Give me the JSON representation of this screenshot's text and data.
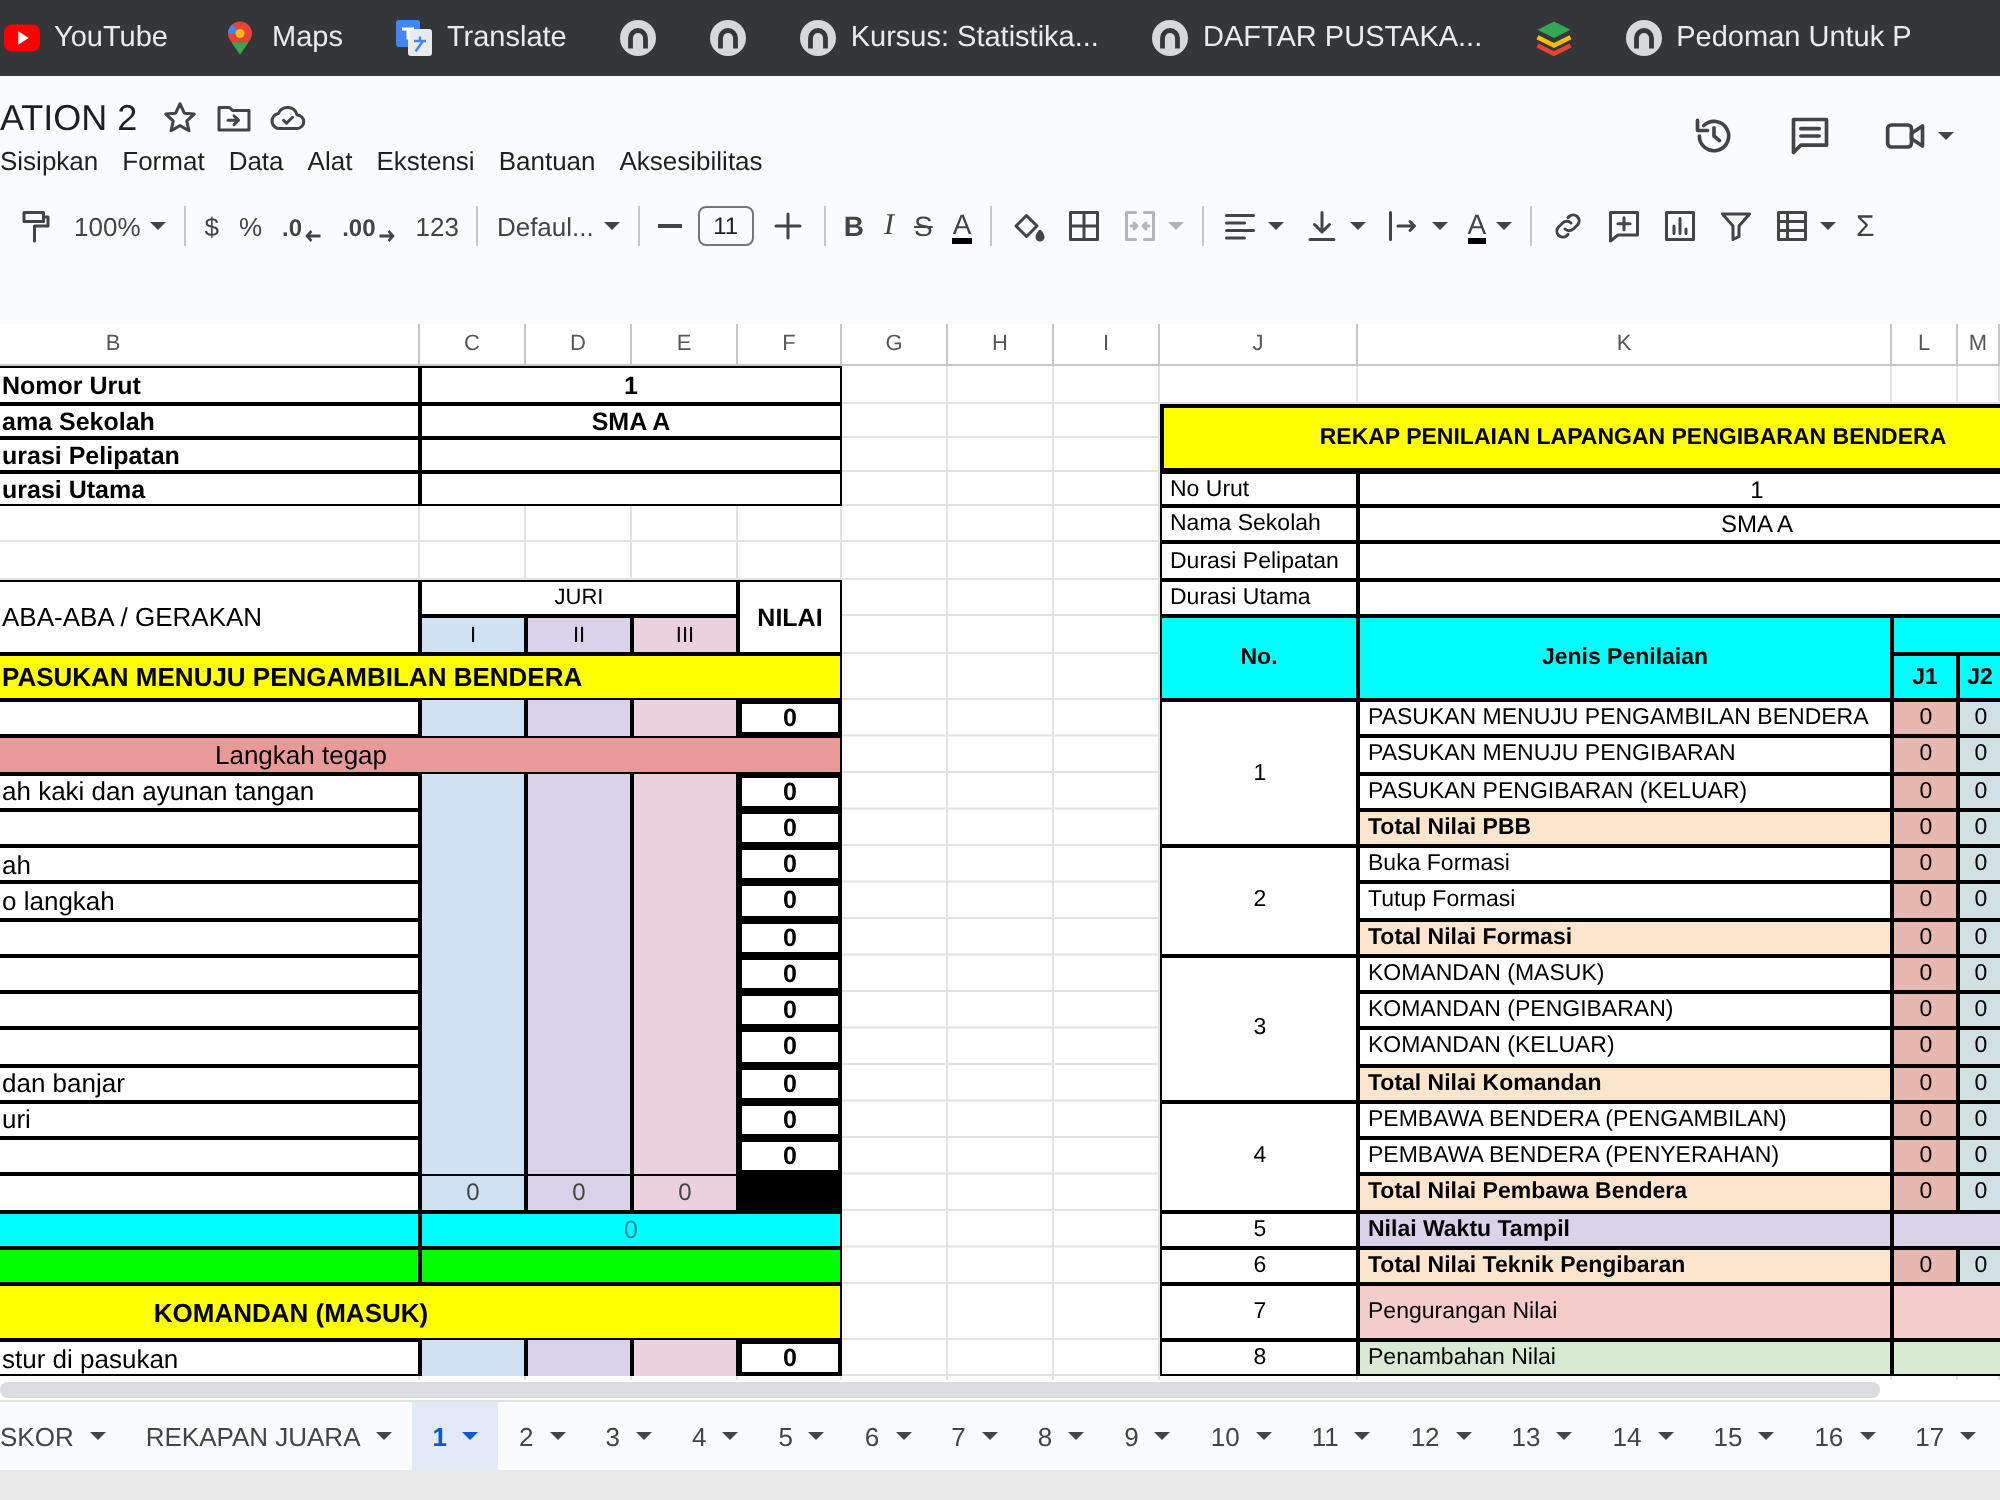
{
  "bookmarks": [
    {
      "kind": "youtube",
      "label": "YouTube"
    },
    {
      "kind": "maps",
      "label": "Maps"
    },
    {
      "kind": "translate",
      "label": "Translate"
    },
    {
      "kind": "site"
    },
    {
      "kind": "site"
    },
    {
      "kind": "site",
      "label": "Kursus: Statistika..."
    },
    {
      "kind": "site",
      "label": "DAFTAR PUSTAKA..."
    },
    {
      "kind": "stack"
    },
    {
      "kind": "site",
      "label": "Pedoman Untuk P"
    }
  ],
  "document": {
    "title": "ATION 2",
    "menu": [
      "Sisipkan",
      "Format",
      "Data",
      "Alat",
      "Ekstensi",
      "Bantuan",
      "Aksesibilitas"
    ]
  },
  "toolbar": {
    "zoom": "100%",
    "currency": "$",
    "percent": "%",
    "decimal_decrease": ".0",
    "decimal_increase": ".00",
    "number_format": "123",
    "font": "Defaul...",
    "font_size": "11",
    "bold": "B",
    "italic": "I",
    "strikethrough": "S",
    "text_color": "A",
    "merge_disabled": true,
    "text_rotation": "A",
    "functions": "Σ"
  },
  "sheet_columns": [
    "B",
    "C",
    "D",
    "E",
    "F",
    "G",
    "H",
    "I",
    "J",
    "K",
    "L",
    "M"
  ],
  "score_sheet": {
    "info": [
      {
        "label": "Nomor Urut",
        "value": "1"
      },
      {
        "label": "ama Sekolah",
        "value": "SMA A"
      },
      {
        "label": "urasi Pelipatan"
      },
      {
        "label": "urasi Utama"
      }
    ],
    "header": {
      "label": "ABA-ABA / GERAKAN",
      "jury": "JURI",
      "judges": [
        "I",
        "II",
        "III"
      ],
      "total": "NILAI"
    },
    "rows": [
      {
        "kind": "section",
        "label": "PASUKAN MENUJU PENGAMBILAN BENDERA"
      },
      {
        "kind": "item",
        "score": "0"
      },
      {
        "kind": "subheader",
        "label": "Langkah tegap"
      },
      {
        "kind": "item",
        "label": "ah kaki dan ayunan tangan",
        "score": "0"
      },
      {
        "kind": "item",
        "score": "0"
      },
      {
        "kind": "item",
        "label": "ah",
        "score": "0"
      },
      {
        "kind": "item",
        "label": "o langkah",
        "score": "0"
      },
      {
        "kind": "item",
        "score": "0"
      },
      {
        "kind": "item",
        "score": "0"
      },
      {
        "kind": "item",
        "score": "0"
      },
      {
        "kind": "item",
        "score": "0"
      },
      {
        "kind": "item",
        "label": "dan banjar",
        "score": "0"
      },
      {
        "kind": "item",
        "label": "uri",
        "score": "0"
      },
      {
        "kind": "item",
        "score": "0"
      },
      {
        "kind": "totals",
        "values": [
          "0",
          "0",
          "0"
        ]
      },
      {
        "kind": "average",
        "value": "0"
      },
      {
        "kind": "final"
      },
      {
        "kind": "title",
        "label": "KOMANDAN (MASUK)"
      },
      {
        "kind": "item",
        "label": "stur di pasukan",
        "score": "0"
      }
    ]
  },
  "rekap": {
    "title": "REKAP PENILAIAN LAPANGAN PENGIBARAN BENDERA",
    "info": [
      {
        "label": "No Urut",
        "value": "1"
      },
      {
        "label": "Nama Sekolah",
        "value": "SMA A"
      },
      {
        "label": "Durasi Pelipatan"
      },
      {
        "label": "Durasi Utama"
      }
    ],
    "columns": {
      "number": "No.",
      "category": "Jenis Penilaian",
      "judges": [
        "J1",
        "J2"
      ]
    },
    "groups": [
      {
        "number": "1",
        "rows": [
          {
            "kind": "item",
            "label": "PASUKAN MENUJU PENGAMBILAN BENDERA",
            "scores": [
              "0",
              "0"
            ]
          },
          {
            "kind": "item",
            "label": "PASUKAN MENUJU PENGIBARAN",
            "scores": [
              "0",
              "0"
            ]
          },
          {
            "kind": "item",
            "label": "PASUKAN PENGIBARAN (KELUAR)",
            "scores": [
              "0",
              "0"
            ]
          },
          {
            "kind": "total",
            "label": "Total Nilai PBB",
            "scores": [
              "0",
              "0"
            ]
          }
        ]
      },
      {
        "number": "2",
        "rows": [
          {
            "kind": "item",
            "label": "Buka Formasi",
            "scores": [
              "0",
              "0"
            ]
          },
          {
            "kind": "item",
            "label": "Tutup Formasi",
            "scores": [
              "0",
              "0"
            ]
          },
          {
            "kind": "total",
            "label": "Total Nilai Formasi",
            "scores": [
              "0",
              "0"
            ]
          }
        ]
      },
      {
        "number": "3",
        "rows": [
          {
            "kind": "item",
            "label": "KOMANDAN (MASUK)",
            "scores": [
              "0",
              "0"
            ]
          },
          {
            "kind": "item",
            "label": "KOMANDAN (PENGIBARAN)",
            "scores": [
              "0",
              "0"
            ]
          },
          {
            "kind": "item",
            "label": "KOMANDAN (KELUAR)",
            "scores": [
              "0",
              "0"
            ]
          },
          {
            "kind": "total",
            "label": "Total Nilai Komandan",
            "scores": [
              "0",
              "0"
            ]
          }
        ]
      },
      {
        "number": "4",
        "rows": [
          {
            "kind": "item",
            "label": "PEMBAWA BENDERA (PENGAMBILAN)",
            "scores": [
              "0",
              "0"
            ]
          },
          {
            "kind": "item",
            "label": "PEMBAWA BENDERA (PENYERAHAN)",
            "scores": [
              "0",
              "0"
            ]
          },
          {
            "kind": "total",
            "label": "Total Nilai Pembawa Bendera",
            "scores": [
              "0",
              "0"
            ]
          }
        ]
      },
      {
        "number": "5",
        "rows": [
          {
            "kind": "time",
            "label": "Nilai Waktu Tampil"
          }
        ]
      },
      {
        "number": "6",
        "rows": [
          {
            "kind": "total",
            "label": "Total Nilai Teknik Pengibaran",
            "scores": [
              "0",
              "0"
            ]
          }
        ]
      },
      {
        "number": "7",
        "rows": [
          {
            "kind": "minus",
            "label": "Pengurangan Nilai"
          }
        ]
      },
      {
        "number": "8",
        "rows": [
          {
            "kind": "plus",
            "label": "Penambahan Nilai"
          }
        ]
      }
    ]
  },
  "sheet_tabs": [
    {
      "label": "SKOR",
      "selected": false
    },
    {
      "label": "REKAPAN JUARA",
      "selected": false
    },
    {
      "label": "1",
      "selected": true
    },
    {
      "label": "2",
      "selected": false
    },
    {
      "label": "3",
      "selected": false
    },
    {
      "label": "4",
      "selected": false
    },
    {
      "label": "5",
      "selected": false
    },
    {
      "label": "6",
      "selected": false
    },
    {
      "label": "7",
      "selected": false
    },
    {
      "label": "8",
      "selected": false
    },
    {
      "label": "9",
      "selected": false
    },
    {
      "label": "10",
      "selected": false
    },
    {
      "label": "11",
      "selected": false
    },
    {
      "label": "12",
      "selected": false
    },
    {
      "label": "13",
      "selected": false
    },
    {
      "label": "14",
      "selected": false
    },
    {
      "label": "15",
      "selected": false
    },
    {
      "label": "16",
      "selected": false
    },
    {
      "label": "17",
      "selected": false
    }
  ]
}
